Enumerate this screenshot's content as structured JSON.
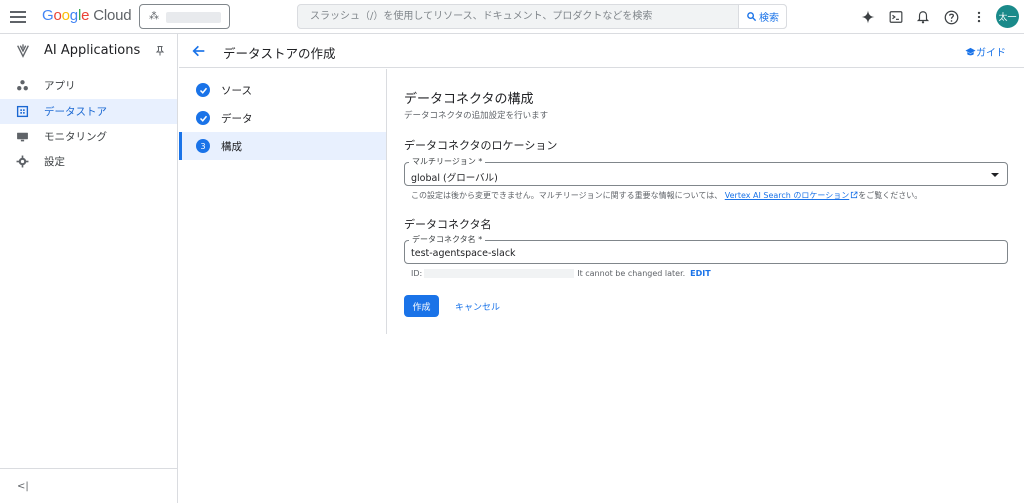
{
  "topbar": {
    "logo_parts": [
      "G",
      "o",
      "o",
      "g",
      "l",
      "e"
    ],
    "logo_cloud": "Cloud",
    "search_placeholder": "スラッシュ（/）を使用してリソース、ドキュメント、プロダクトなどを検索",
    "search_button": "検索",
    "avatar_text": "太一",
    "icons": [
      "gemini-spark-icon",
      "cloud-shell-icon",
      "notifications-icon",
      "help-icon",
      "more-vert-icon"
    ]
  },
  "sidebar": {
    "title": "AI Applications",
    "items": [
      {
        "label": "アプリ",
        "icon": "apps-icon",
        "active": false
      },
      {
        "label": "データストア",
        "icon": "datastore-icon",
        "active": true
      },
      {
        "label": "モニタリング",
        "icon": "monitoring-icon",
        "active": false
      },
      {
        "label": "設定",
        "icon": "settings-icon",
        "active": false
      }
    ],
    "collapse_label": "<|"
  },
  "page_header": {
    "title": "データストアの作成",
    "guide_label": "ガイド"
  },
  "stepper": {
    "steps": [
      {
        "label": "ソース",
        "state": "done",
        "number": ""
      },
      {
        "label": "データ",
        "state": "done",
        "number": ""
      },
      {
        "label": "構成",
        "state": "active",
        "number": "3"
      }
    ]
  },
  "form": {
    "title": "データコネクタの構成",
    "subtitle": "データコネクタの追加設定を行います",
    "location_section": "データコネクタのロケーション",
    "location_field_label": "マルチリージョン *",
    "location_value": "global (グローバル)",
    "location_hint_prefix": "この設定は後から変更できません。マルチリージョンに関する重要な情報については、",
    "location_hint_link": "Vertex AI Search のロケーション",
    "location_hint_suffix": "をご覧ください。",
    "name_section": "データコネクタ名",
    "name_field_label": "データコネクタ名 *",
    "name_value": "test-agentspace-slack",
    "id_label": "ID:",
    "id_note": "It cannot be changed later.",
    "edit_label": "EDIT",
    "create_button": "作成",
    "cancel_button": "キャンセル"
  },
  "colors": {
    "accent": "#1a73e8",
    "active_bg": "#e8f0fe",
    "avatar_bg": "#1a8a8a",
    "border": "#dadce0"
  }
}
